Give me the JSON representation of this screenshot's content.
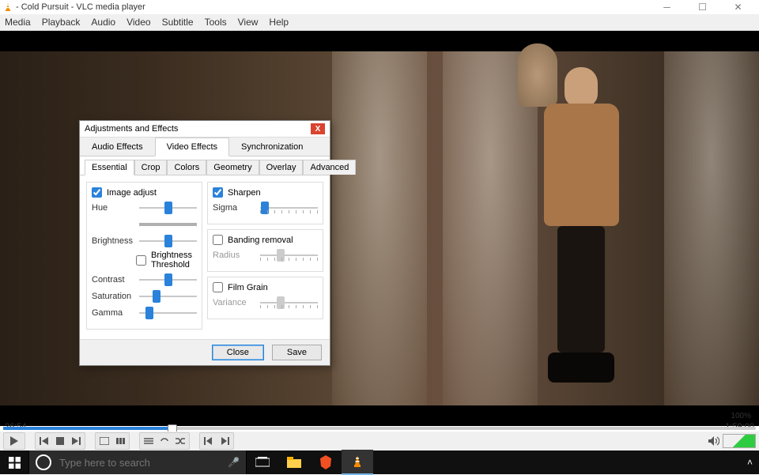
{
  "window": {
    "title": "- Cold Pursuit - VLC media player",
    "menus": [
      "Media",
      "Playback",
      "Audio",
      "Video",
      "Subtitle",
      "Tools",
      "View",
      "Help"
    ]
  },
  "playback": {
    "elapsed": "26:54",
    "total": "1:59:00",
    "position_pct": 22.5,
    "volume_pct": "100%"
  },
  "dialog": {
    "title": "Adjustments and Effects",
    "tabs": [
      "Audio Effects",
      "Video Effects",
      "Synchronization"
    ],
    "active_tab": "Video Effects",
    "subtabs": [
      "Essential",
      "Crop",
      "Colors",
      "Geometry",
      "Overlay",
      "Advanced"
    ],
    "active_subtab": "Essential",
    "image_adjust": {
      "label": "Image adjust",
      "checked": true,
      "hue": "Hue",
      "brightness": "Brightness",
      "brightness_threshold": "Brightness Threshold",
      "brightness_threshold_checked": false,
      "contrast": "Contrast",
      "saturation": "Saturation",
      "gamma": "Gamma",
      "values": {
        "hue": 50,
        "brightness": 50,
        "contrast": 50,
        "saturation": 30,
        "gamma": 18
      }
    },
    "sharpen": {
      "label": "Sharpen",
      "checked": true,
      "sigma_label": "Sigma",
      "sigma": 8
    },
    "banding": {
      "label": "Banding removal",
      "checked": false,
      "radius_label": "Radius",
      "radius": 35
    },
    "film_grain": {
      "label": "Film Grain",
      "checked": false,
      "variance_label": "Variance",
      "variance": 35
    },
    "buttons": {
      "close": "Close",
      "save": "Save"
    }
  },
  "taskbar": {
    "search_placeholder": "Type here to search"
  }
}
